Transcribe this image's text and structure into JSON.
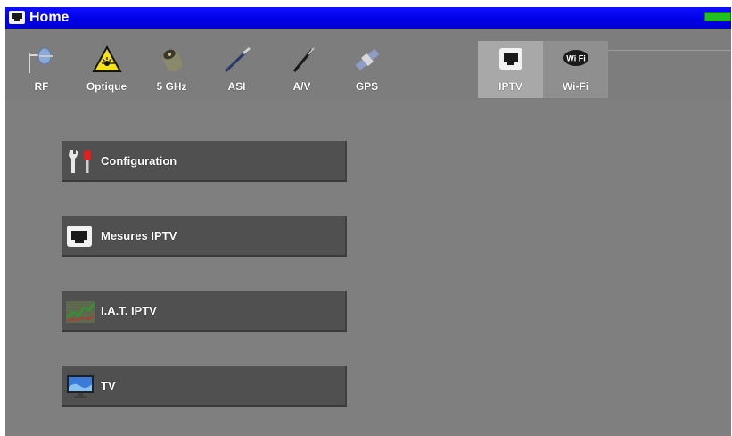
{
  "window": {
    "title": "Home",
    "title_icon": "ethernet-port-icon",
    "battery_color": "#20c020",
    "titlebar_color": "#0000e6"
  },
  "tabs": [
    {
      "label": "RF",
      "icon": "antenna-icon",
      "active": false
    },
    {
      "label": "Optique",
      "icon": "laser-warning-icon",
      "active": false
    },
    {
      "label": "5 GHz",
      "icon": "coax-connector-icon",
      "active": false
    },
    {
      "label": "ASI",
      "icon": "asi-cable-icon",
      "active": false
    },
    {
      "label": "A/V",
      "icon": "av-cable-icon",
      "active": false
    },
    {
      "label": "GPS",
      "icon": "satellite-icon",
      "active": false
    },
    {
      "label": "IPTV",
      "icon": "ethernet-port-icon",
      "active": true
    },
    {
      "label": "Wi-Fi",
      "icon": "wifi-logo-icon",
      "active": false
    }
  ],
  "menu": [
    {
      "label": "Configuration",
      "icon": "tools-icon"
    },
    {
      "label": "Mesures IPTV",
      "icon": "ethernet-port-icon"
    },
    {
      "label": "I.A.T. IPTV",
      "icon": "graph-icon"
    },
    {
      "label": "TV",
      "icon": "tv-icon"
    }
  ]
}
